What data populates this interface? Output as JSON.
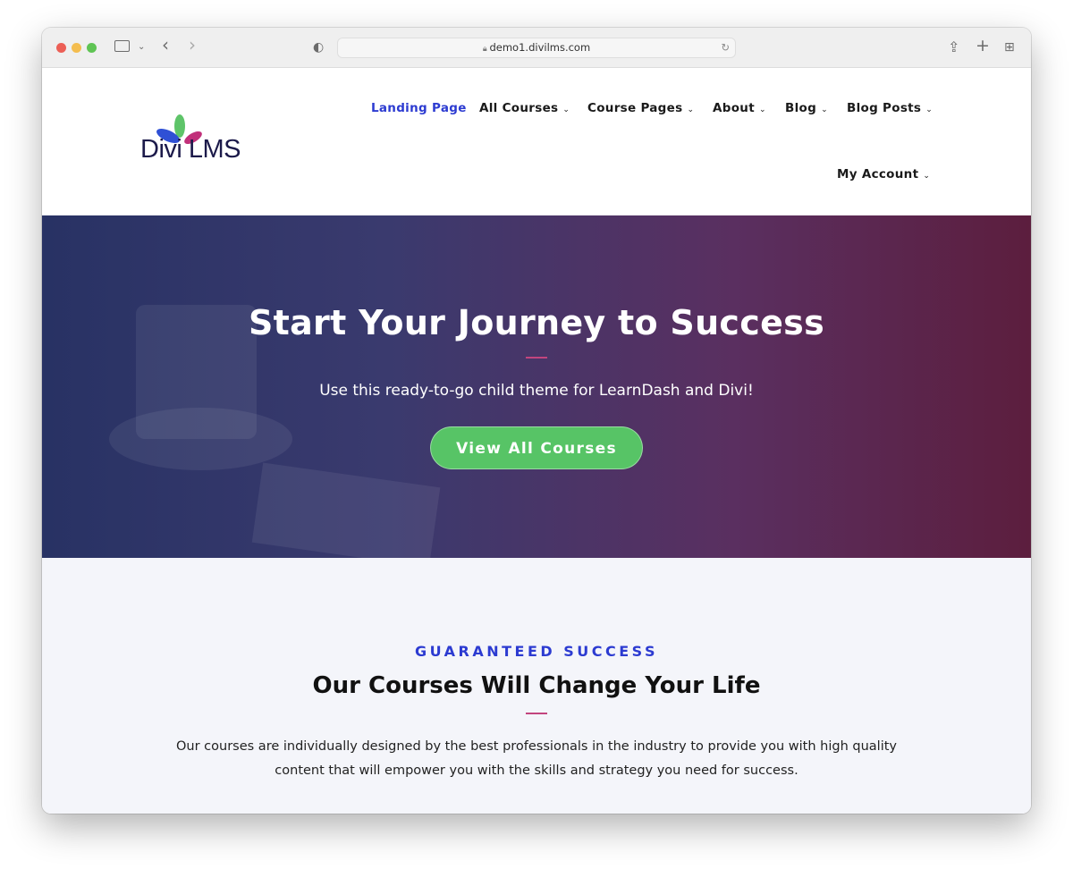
{
  "browser": {
    "url": "demo1.divilms.com"
  },
  "logo": {
    "text": "Divi LMS"
  },
  "nav": {
    "items": [
      {
        "label": "Landing Page",
        "active": true
      },
      {
        "label": "All Courses"
      },
      {
        "label": "Course Pages"
      },
      {
        "label": "About"
      },
      {
        "label": "Blog"
      },
      {
        "label": "Blog Posts"
      },
      {
        "label": "My Account"
      }
    ],
    "active_color": "#2c3bd1"
  },
  "hero": {
    "title": "Start Your Journey to Success",
    "subtitle": "Use this ready-to-go child theme for LearnDash and Divi!",
    "cta_label": "View All Courses"
  },
  "intro": {
    "eyebrow": "GUARANTEED SUCCESS",
    "title": "Our Courses Will Change Your Life",
    "body": "Our courses are individually designed by the best professionals in the industry to provide you with high quality content that will empower you with the skills and strategy you need for success."
  },
  "colors": {
    "accent": "#2c3bd1",
    "cta": "#57c466",
    "divider": "#c2457e"
  }
}
